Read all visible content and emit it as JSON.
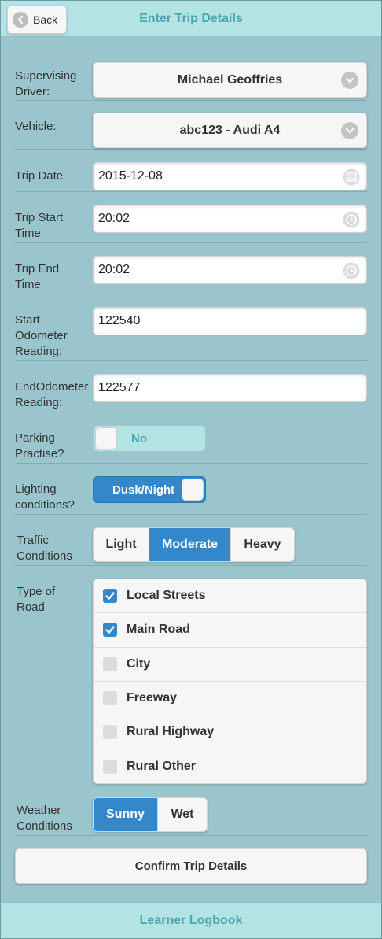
{
  "header": {
    "title": "Enter Trip Details",
    "back_label": "Back"
  },
  "fields": {
    "supervising_driver": {
      "label_1": "Supervising",
      "label_2": "Driver:",
      "value": "Michael Geoffries"
    },
    "vehicle": {
      "label": "Vehicle:",
      "value": "abc123 - Audi A4"
    },
    "trip_date": {
      "label": "Trip Date",
      "value": "2015-12-08"
    },
    "trip_start": {
      "label_1": "Trip Start",
      "label_2": "Time",
      "value": "20:02"
    },
    "trip_end": {
      "label_1": "Trip End",
      "label_2": "Time",
      "value": "20:02"
    },
    "start_odometer": {
      "label_1": "Start",
      "label_2": "Odometer",
      "label_3": "Reading:",
      "value": "122540"
    },
    "end_odometer": {
      "label_1": "EndOdometer",
      "label_2": "Reading:",
      "value": "122577"
    },
    "parking": {
      "label_1": "Parking",
      "label_2": "Practise?",
      "value": "No"
    },
    "lighting": {
      "label_1": "Lighting",
      "label_2": "conditions?",
      "value": "Dusk/Night"
    },
    "traffic": {
      "label_1": "Traffic",
      "label_2": "Conditions",
      "options": [
        "Light",
        "Moderate",
        "Heavy"
      ],
      "selected": "Moderate"
    },
    "road_type": {
      "label_1": "Type of",
      "label_2": "Road",
      "items": [
        {
          "label": "Local Streets",
          "checked": true
        },
        {
          "label": "Main Road",
          "checked": true
        },
        {
          "label": "City",
          "checked": false
        },
        {
          "label": "Freeway",
          "checked": false
        },
        {
          "label": "Rural Highway",
          "checked": false
        },
        {
          "label": "Rural Other",
          "checked": false
        }
      ]
    },
    "weather": {
      "label_1": "Weather",
      "label_2": "Conditions",
      "options": [
        "Sunny",
        "Wet"
      ],
      "selected": "Sunny"
    }
  },
  "confirm_label": "Confirm Trip Details",
  "footer": {
    "title": "Learner Logbook"
  },
  "colors": {
    "accent": "#3388cc",
    "header_bg": "#b3e3e3",
    "page_bg": "#9bc5cc",
    "header_text": "#4aa7b3"
  },
  "icons": {
    "back": "chevron-left-icon",
    "select": "chevron-down-icon",
    "date": "calendar-icon",
    "time": "clock-icon",
    "check": "check-icon"
  }
}
